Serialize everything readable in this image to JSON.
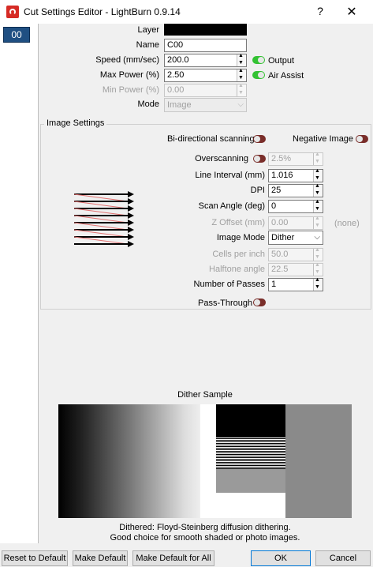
{
  "window": {
    "title": "Cut Settings Editor - LightBurn 0.9.14",
    "help_label": "?",
    "close_label": "✕"
  },
  "sidebar": {
    "layer_chip": "00"
  },
  "form": {
    "layer_label": "Layer",
    "layer_color": "#000000",
    "name_label": "Name",
    "name_value": "C00",
    "speed_label": "Speed (mm/sec)",
    "speed_value": "200.0",
    "output_label": "Output",
    "max_power_label": "Max Power (%)",
    "max_power_value": "2.50",
    "air_assist_label": "Air Assist",
    "min_power_label": "Min Power (%)",
    "min_power_value": "0.00",
    "mode_label": "Mode",
    "mode_value": "Image"
  },
  "image_settings": {
    "group_title": "Image Settings",
    "bidirectional_label": "Bi-directional scanning",
    "negative_label": "Negative Image",
    "overscanning_label": "Overscanning",
    "overscanning_value": "2.5%",
    "line_interval_label": "Line Interval (mm)",
    "line_interval_value": "1.016",
    "dpi_label": "DPI",
    "dpi_value": "25",
    "scan_angle_label": "Scan Angle (deg)",
    "scan_angle_value": "0",
    "z_offset_label": "Z Offset (mm)",
    "z_offset_value": "0.00",
    "z_offset_note": "(none)",
    "image_mode_label": "Image Mode",
    "image_mode_value": "Dither",
    "cells_label": "Cells per inch",
    "cells_value": "50.0",
    "halftone_label": "Halftone angle",
    "halftone_value": "22.5",
    "passes_label": "Number of Passes",
    "passes_value": "1",
    "pass_through_label": "Pass-Through"
  },
  "dither": {
    "heading": "Dither Sample",
    "caption_line1": "Dithered: Floyd-Steinberg diffusion dithering.",
    "caption_line2": "Good choice for smooth shaded or photo images."
  },
  "buttons": {
    "reset_default": "Reset to Default",
    "make_default": "Make Default",
    "make_default_all": "Make Default for All",
    "ok": "OK",
    "cancel": "Cancel"
  },
  "colors": {
    "toggle_on": "#33c233",
    "toggle_off": "#7a2e2a",
    "layer_chip_bg": "#1f4f82",
    "app_icon": "#d62b25"
  }
}
